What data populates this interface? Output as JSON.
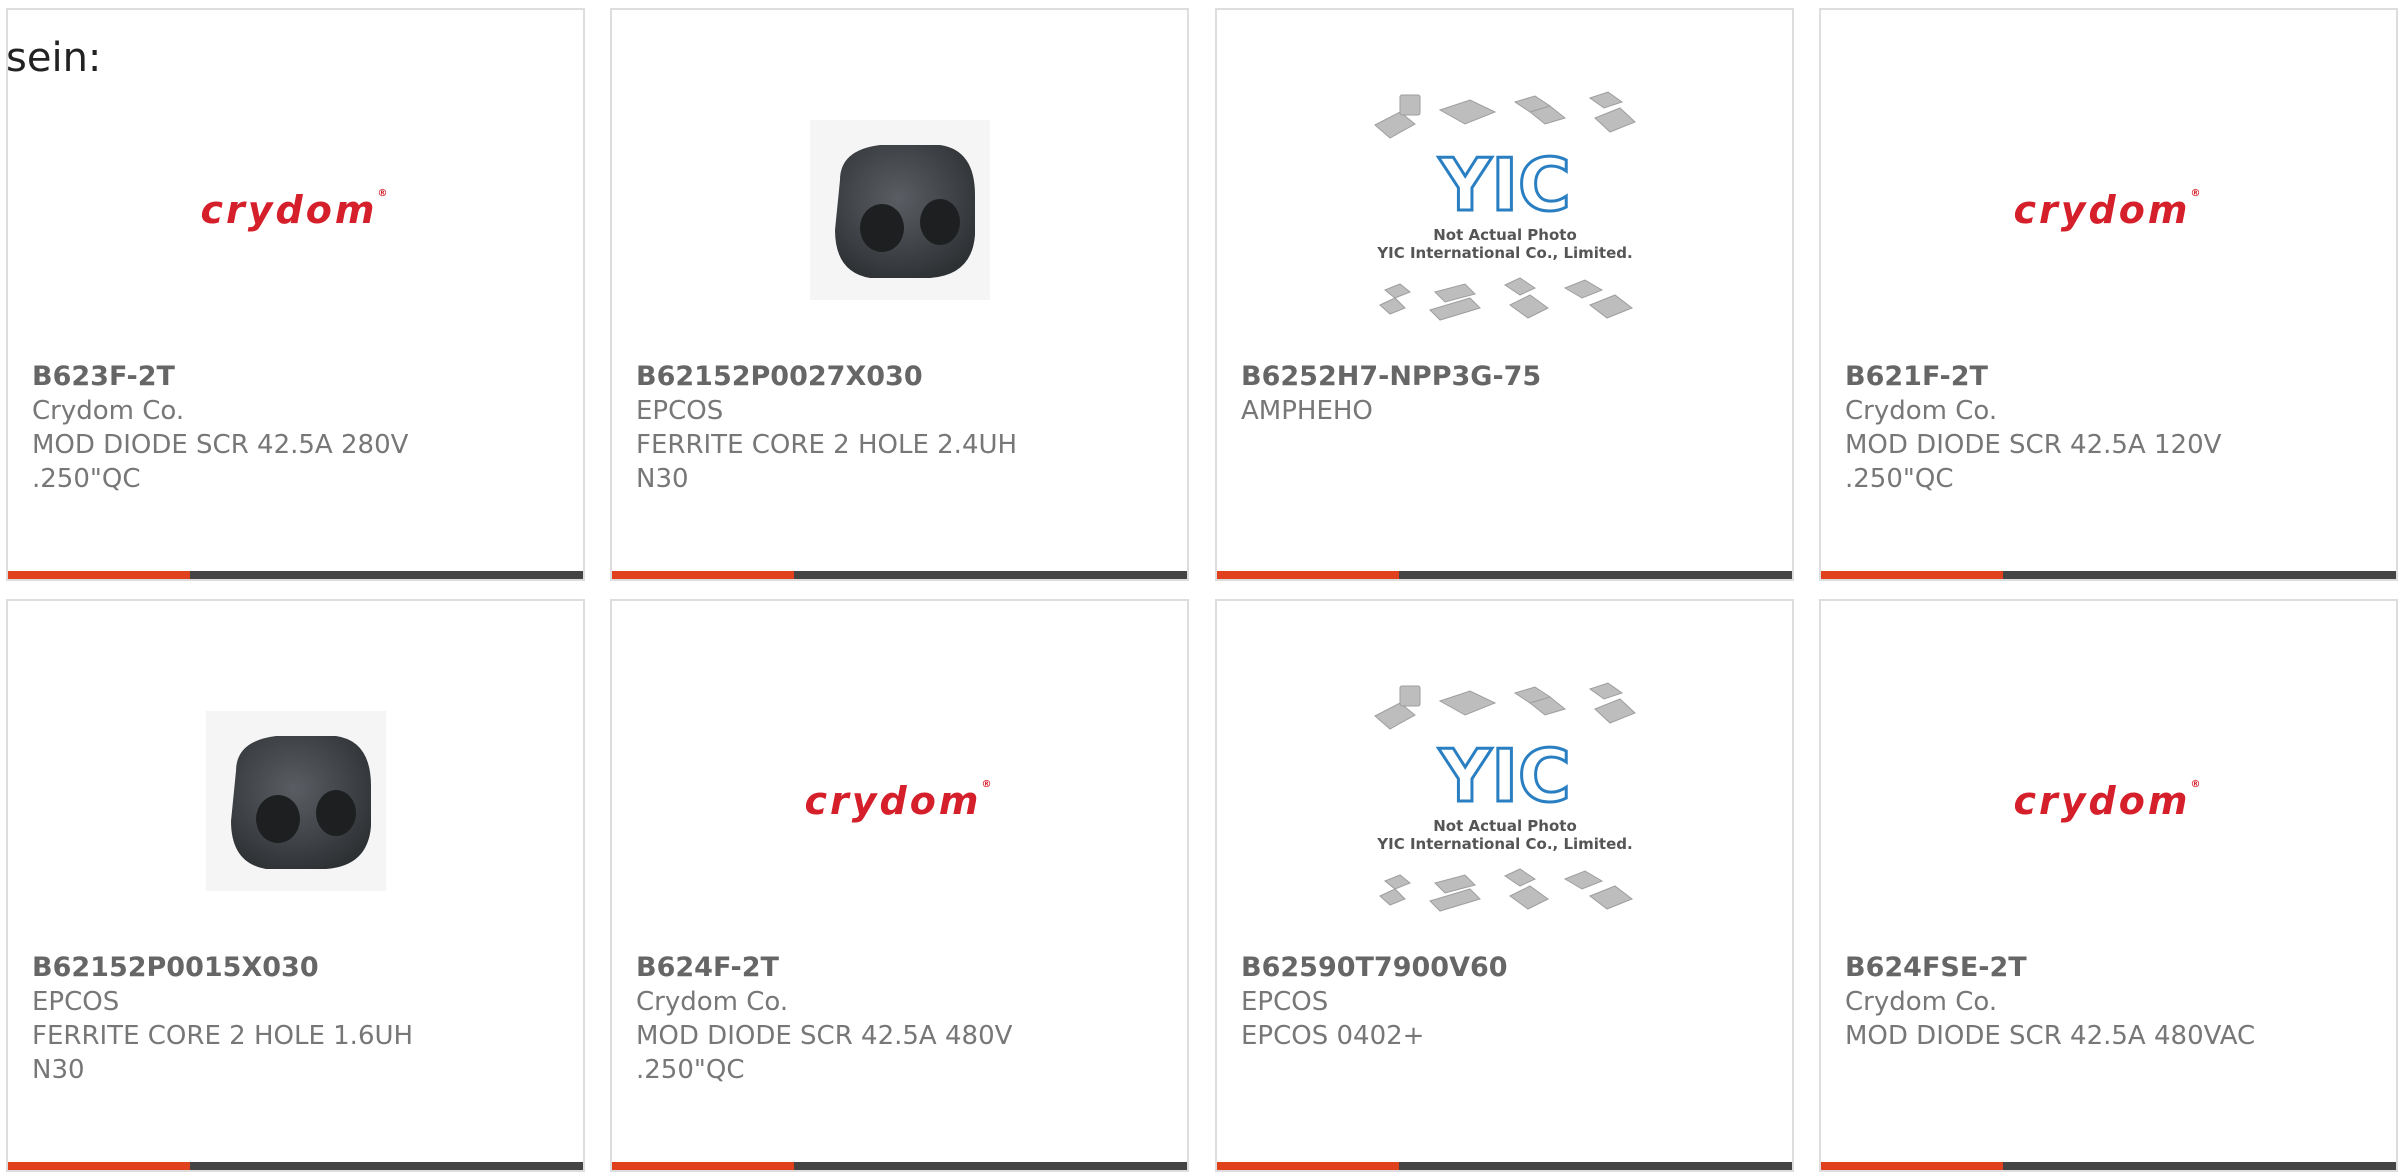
{
  "fragment_text": "sein:",
  "colors": {
    "accent": "#e0401c",
    "bar_dark": "#444444",
    "logo_red": "#d51f2a"
  },
  "products": [
    {
      "part_number": "B623F-2T",
      "manufacturer": "Crydom Co.",
      "description": "MOD DIODE SCR 42.5A 280V\n.250\"QC",
      "image": "crydom-logo"
    },
    {
      "part_number": "B62152P0027X030",
      "manufacturer": "EPCOS",
      "description": "FERRITE CORE 2 HOLE 2.4UH\nN30",
      "image": "ferrite-core"
    },
    {
      "part_number": "B6252H7-NPP3G-75",
      "manufacturer": "AMPHEHO",
      "description": "",
      "image": "yic-placeholder"
    },
    {
      "part_number": "B621F-2T",
      "manufacturer": "Crydom Co.",
      "description": "MOD DIODE SCR 42.5A 120V\n.250\"QC",
      "image": "crydom-logo"
    },
    {
      "part_number": "B62152P0015X030",
      "manufacturer": "EPCOS",
      "description": "FERRITE CORE 2 HOLE 1.6UH\nN30",
      "image": "ferrite-core"
    },
    {
      "part_number": "B624F-2T",
      "manufacturer": "Crydom Co.",
      "description": "MOD DIODE SCR 42.5A 480V\n.250\"QC",
      "image": "crydom-logo"
    },
    {
      "part_number": "B62590T7900V60",
      "manufacturer": "EPCOS",
      "description": "EPCOS 0402+",
      "image": "yic-placeholder"
    },
    {
      "part_number": "B624FSE-2T",
      "manufacturer": "Crydom Co.",
      "description": "MOD DIODE SCR 42.5A 480VAC",
      "image": "crydom-logo"
    }
  ],
  "crydom_logo_text": "crydom",
  "yic_placeholder": {
    "logo": "YIC",
    "line1": "Not Actual Photo",
    "line2": "YIC International Co., Limited."
  }
}
